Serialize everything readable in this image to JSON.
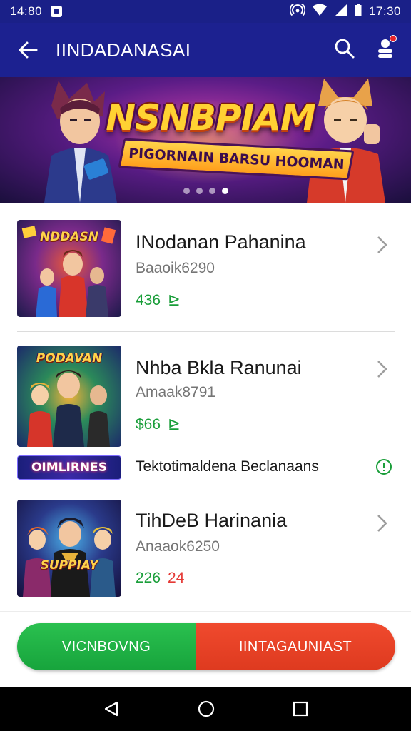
{
  "status_bar": {
    "time_left": "14:80",
    "time_right": "17:30",
    "icons": [
      "notification-icon",
      "hotspot-icon",
      "wifi-icon",
      "signal-icon",
      "battery-icon"
    ]
  },
  "app_bar": {
    "title": "IINDADANASAI",
    "icons": [
      "back-arrow-icon",
      "search-icon",
      "profile-icon"
    ]
  },
  "banner": {
    "title": "NSNBPIAM",
    "subtitle": "PIGORNAIN BARSU HOOMAN",
    "dots": 4,
    "active_dot": 3
  },
  "games": [
    {
      "thumb_label": "NDDASN",
      "name": "INodanan Pahanina",
      "sub": "Baaoik6290",
      "price": "436",
      "price_color": "#1a9e3a",
      "badge_symbol": "⊵",
      "badge_color": "#1a9e3a"
    },
    {
      "thumb_label": "PODAVAN",
      "name": "Nhba Bkla Ranunai",
      "sub": "Amaak8791",
      "price": "$66",
      "price_color": "#1a9e3a",
      "badge_symbol": "⊵",
      "badge_color": "#1a9e3a"
    },
    {
      "thumb_label": "SUPPIAY",
      "name": "TihDeB Harinania",
      "sub": "Anaaok6250",
      "price": "226",
      "price_color": "#1a9e3a",
      "badge_symbol": "24",
      "badge_color": "#e53935"
    }
  ],
  "promo": {
    "badge": "OIMLIRNES",
    "text": "Tektotimaldena Beclanaans",
    "info_color": "#1a9e3a"
  },
  "bottom_buttons": {
    "left_label": "VICNBOVNG",
    "right_label": "IINTAGAUNIAST",
    "left_color": "#1ea846",
    "right_color": "#e8452a"
  },
  "nav_bar": {
    "icons": [
      "back-triangle-icon",
      "home-circle-icon",
      "recents-square-icon"
    ]
  }
}
